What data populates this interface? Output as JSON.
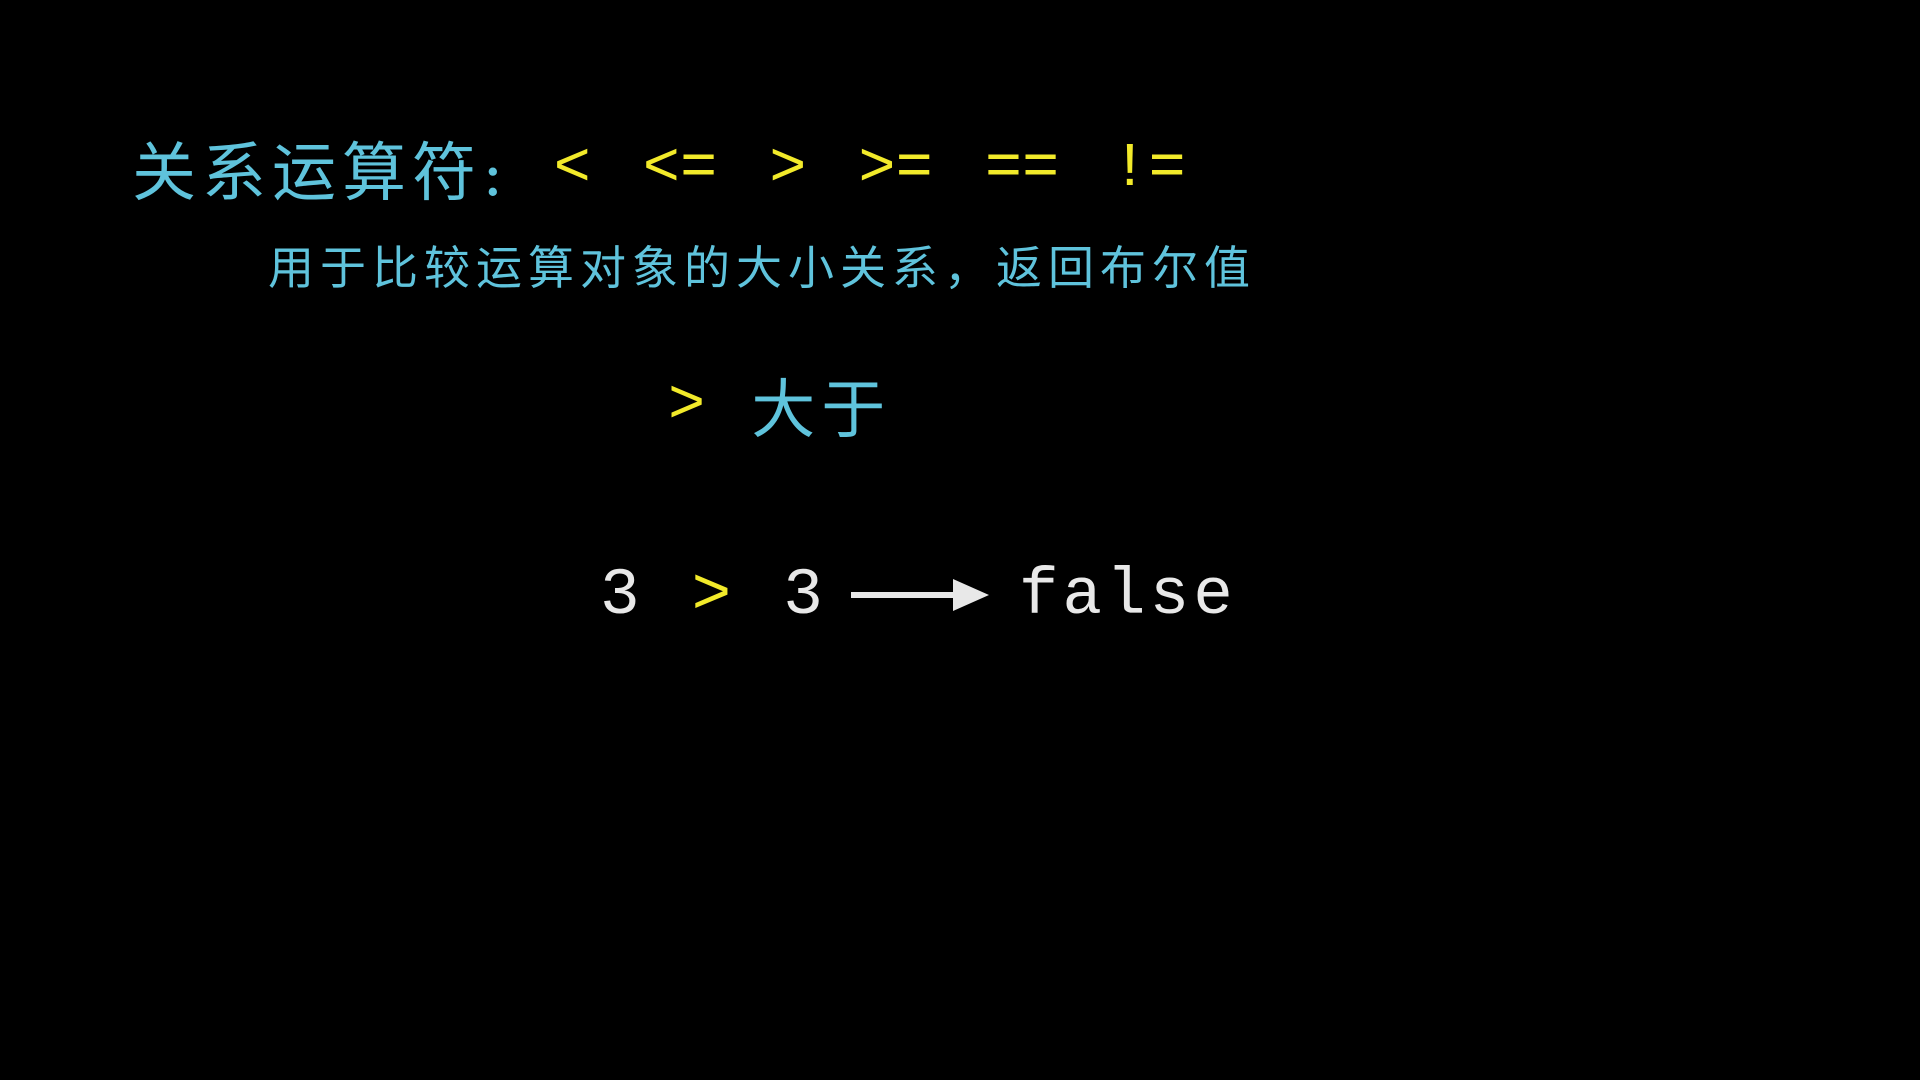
{
  "slide": {
    "title": "关系运算符:",
    "operators": [
      "<",
      "<=",
      ">",
      ">=",
      "==",
      "!="
    ],
    "subtitle": "用于比较运算对象的大小关系，返回布尔值",
    "focus": {
      "symbol": ">",
      "meaning": "大于"
    },
    "example": {
      "left_operand": "3",
      "operator": ">",
      "right_operand": "3",
      "result": "false"
    }
  },
  "colors": {
    "background": "#000000",
    "title": "#5fc3dc",
    "operator": "#f2ea2a",
    "example_text": "#e8e8e8",
    "arrow": "#e8e8e8"
  },
  "icons": {
    "arrow": "right-arrow-icon"
  }
}
